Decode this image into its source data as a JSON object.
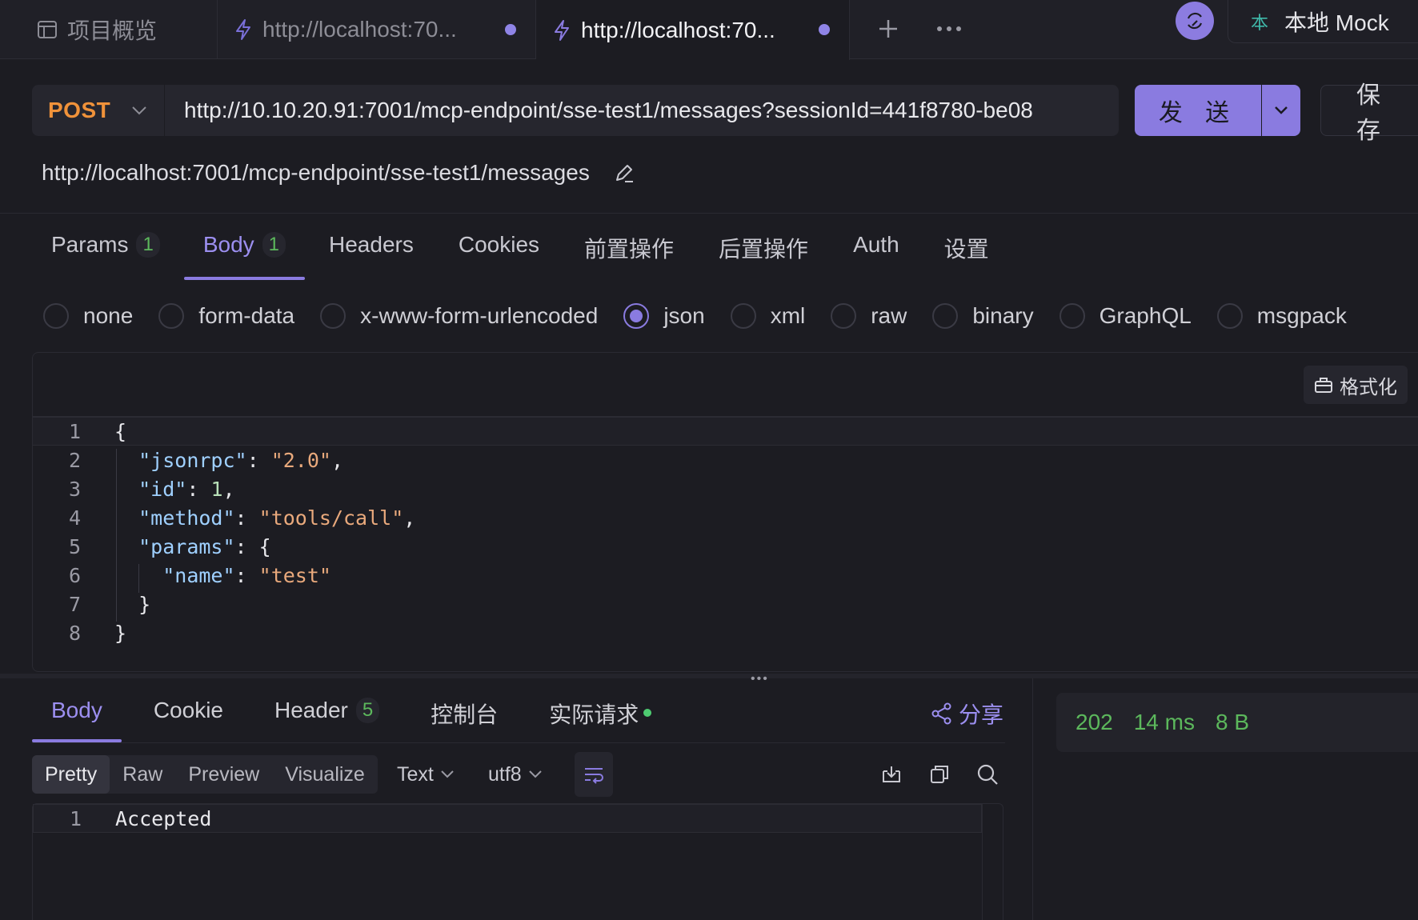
{
  "tabs": {
    "overview_label": "项目概览",
    "items": [
      {
        "label": "http://localhost:70...",
        "unsaved": true
      },
      {
        "label": "http://localhost:70...",
        "unsaved": true
      }
    ]
  },
  "environment": {
    "badge": "本",
    "label": "本地 Mock"
  },
  "request": {
    "method": "POST",
    "url": "http://10.10.20.91:7001/mcp-endpoint/sse-test1/messages?sessionId=441f8780-be08",
    "send_label": "发 送",
    "save_label": "保 存",
    "path": "http://localhost:7001/mcp-endpoint/sse-test1/messages"
  },
  "req_tabs": [
    {
      "label": "Params",
      "count": "1"
    },
    {
      "label": "Body",
      "count": "1"
    },
    {
      "label": "Headers",
      "count": ""
    },
    {
      "label": "Cookies",
      "count": ""
    },
    {
      "label": "前置操作",
      "count": ""
    },
    {
      "label": "后置操作",
      "count": ""
    },
    {
      "label": "Auth",
      "count": ""
    },
    {
      "label": "设置",
      "count": ""
    }
  ],
  "body_types": [
    "none",
    "form-data",
    "x-www-form-urlencoded",
    "json",
    "xml",
    "raw",
    "binary",
    "GraphQL",
    "msgpack"
  ],
  "body_type_selected": "json",
  "editor": {
    "format_label": "格式化",
    "line_numbers": [
      "1",
      "2",
      "3",
      "4",
      "5",
      "6",
      "7",
      "8"
    ]
  },
  "response": {
    "tabs": [
      {
        "label": "Body",
        "count": ""
      },
      {
        "label": "Cookie",
        "count": ""
      },
      {
        "label": "Header",
        "count": "5"
      },
      {
        "label": "控制台",
        "count": ""
      },
      {
        "label": "实际请求",
        "count": ""
      }
    ],
    "share_label": "分享",
    "view_modes": [
      "Pretty",
      "Raw",
      "Preview",
      "Visualize"
    ],
    "format": "Text",
    "encoding": "utf8",
    "line_number": "1",
    "body_text": "Accepted",
    "status": "202",
    "time": "14 ms",
    "size": "8 B"
  },
  "colors": {
    "accent": "#8a7be0",
    "method_post": "#f0923a",
    "success": "#5cb85c"
  }
}
